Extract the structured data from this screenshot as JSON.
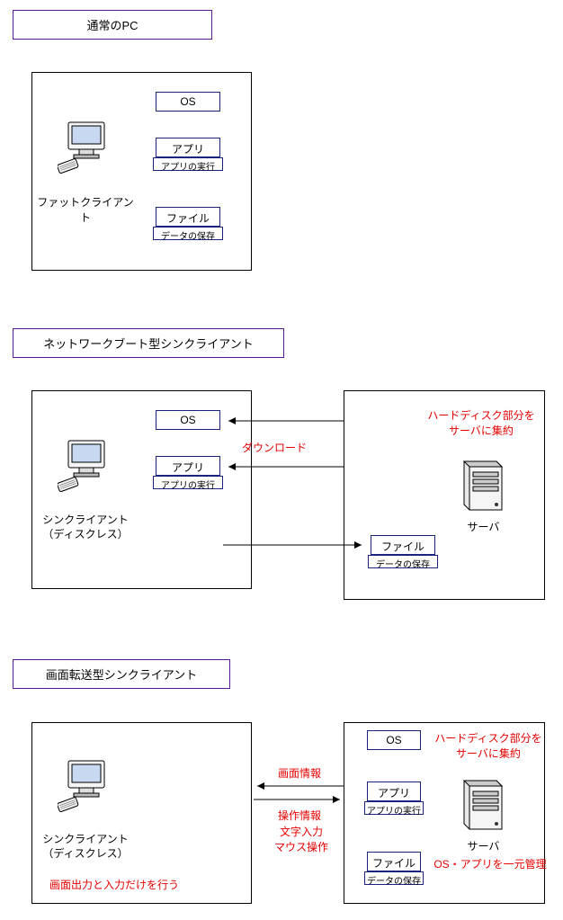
{
  "sections": {
    "s1": {
      "title": "通常のPC",
      "client_label": "ファットクライアント",
      "boxes": {
        "os": "OS",
        "app": "アプリ",
        "app_caption": "アプリの実行",
        "file": "ファイル",
        "file_caption": "データの保存"
      }
    },
    "s2": {
      "title": "ネットワークブート型シンクライアント",
      "client_label": "シンクライアント",
      "client_sub": "（ディスクレス）",
      "server_label": "サーバ",
      "server_note": "ハードディスク部分を\nサーバに集約",
      "download_label": "ダウンロード",
      "boxes": {
        "os": "OS",
        "app": "アプリ",
        "app_caption": "アプリの実行",
        "file": "ファイル",
        "file_caption": "データの保存"
      }
    },
    "s3": {
      "title": "画面転送型シンクライアント",
      "client_label": "シンクライアント",
      "client_sub": "（ディスクレス）",
      "client_note": "画面出力と入力だけを行う",
      "server_label": "サーバ",
      "server_note1": "ハードディスク部分を\nサーバに集約",
      "server_note2": "OS・アプリを一元管理",
      "screen_info": "画面情報",
      "op_info": "操作情報",
      "op_sub": "文字入力\nマウス操作",
      "boxes": {
        "os": "OS",
        "app": "アプリ",
        "app_caption": "アプリの実行",
        "file": "ファイル",
        "file_caption": "データの保存"
      }
    }
  }
}
